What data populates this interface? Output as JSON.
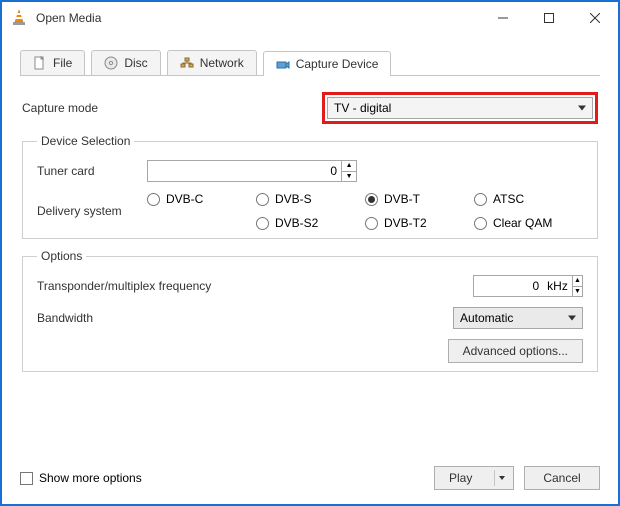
{
  "window": {
    "title": "Open Media"
  },
  "tabs": {
    "file": "File",
    "disc": "Disc",
    "network": "Network",
    "capture": "Capture Device"
  },
  "capture_mode": {
    "label": "Capture mode",
    "value": "TV - digital"
  },
  "device_selection": {
    "legend": "Device Selection",
    "tuner_label": "Tuner card",
    "tuner_value": "0",
    "delivery_label": "Delivery system",
    "radios": {
      "dvbc": "DVB-C",
      "dvbs": "DVB-S",
      "dvbt": "DVB-T",
      "atsc": "ATSC",
      "dvbs2": "DVB-S2",
      "dvbt2": "DVB-T2",
      "clearqam": "Clear QAM"
    }
  },
  "options": {
    "legend": "Options",
    "freq_label": "Transponder/multiplex frequency",
    "freq_value": "0",
    "freq_unit": "kHz",
    "bandwidth_label": "Bandwidth",
    "bandwidth_value": "Automatic",
    "advanced": "Advanced options..."
  },
  "footer": {
    "show_more": "Show more options",
    "play": "Play",
    "cancel": "Cancel"
  }
}
